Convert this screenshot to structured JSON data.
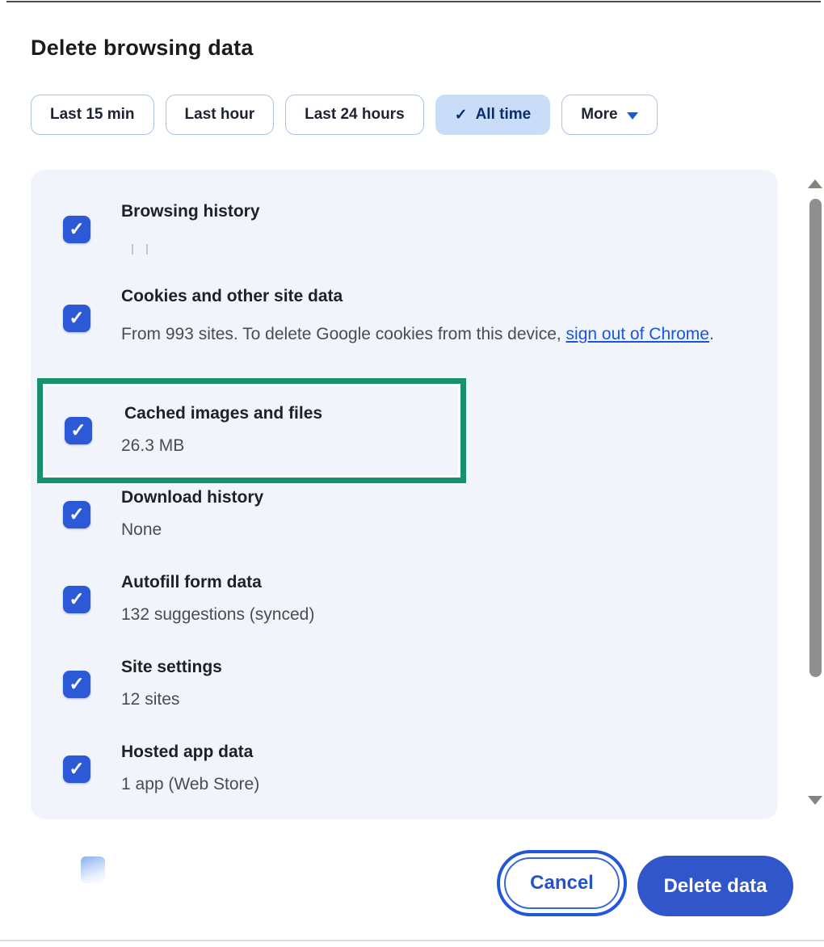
{
  "dialog": {
    "title": "Delete browsing data",
    "chips": [
      {
        "label": "Last 15 min",
        "selected": false
      },
      {
        "label": "Last hour",
        "selected": false
      },
      {
        "label": "Last 24 hours",
        "selected": false
      },
      {
        "label": "All time",
        "selected": true
      },
      {
        "label": "More",
        "selected": false,
        "has_dropdown": true
      }
    ],
    "items": [
      {
        "label": "Browsing history",
        "checked": true
      },
      {
        "label": "Cookies and other site data",
        "checked": true,
        "sub_prefix": "From 993 sites. To delete Google cookies from this device, ",
        "sub_link": "sign out of Chrome",
        "sub_suffix": "."
      },
      {
        "label": "Cached images and files",
        "sublabel": "26.3 MB",
        "checked": true,
        "annotated": true
      },
      {
        "label": "Download history",
        "sublabel": "None",
        "checked": true
      },
      {
        "label": "Autofill form data",
        "sublabel": "132 suggestions (synced)",
        "checked": true
      },
      {
        "label": "Site settings",
        "sublabel": "12 sites",
        "checked": true
      },
      {
        "label": "Hosted app data",
        "sublabel": "1 app (Web Store)",
        "checked": true
      }
    ],
    "buttons": {
      "cancel_label": "Cancel",
      "confirm_label": "Delete data"
    }
  },
  "icons": {
    "check": "✓",
    "chip_check": "✓",
    "dropdown_arrow": "▼",
    "scroll_up": "▲",
    "scroll_down": "▼"
  },
  "colors": {
    "accent_blue": "#2c59d6",
    "selected_chip_bg": "#c9ddf9",
    "selected_chip_text": "#0a2d6e",
    "link_blue": "#1756e3",
    "annotation_green": "#17906c",
    "confirm_button_bg": "#3156c9",
    "list_bg": "#f1f5fb"
  }
}
